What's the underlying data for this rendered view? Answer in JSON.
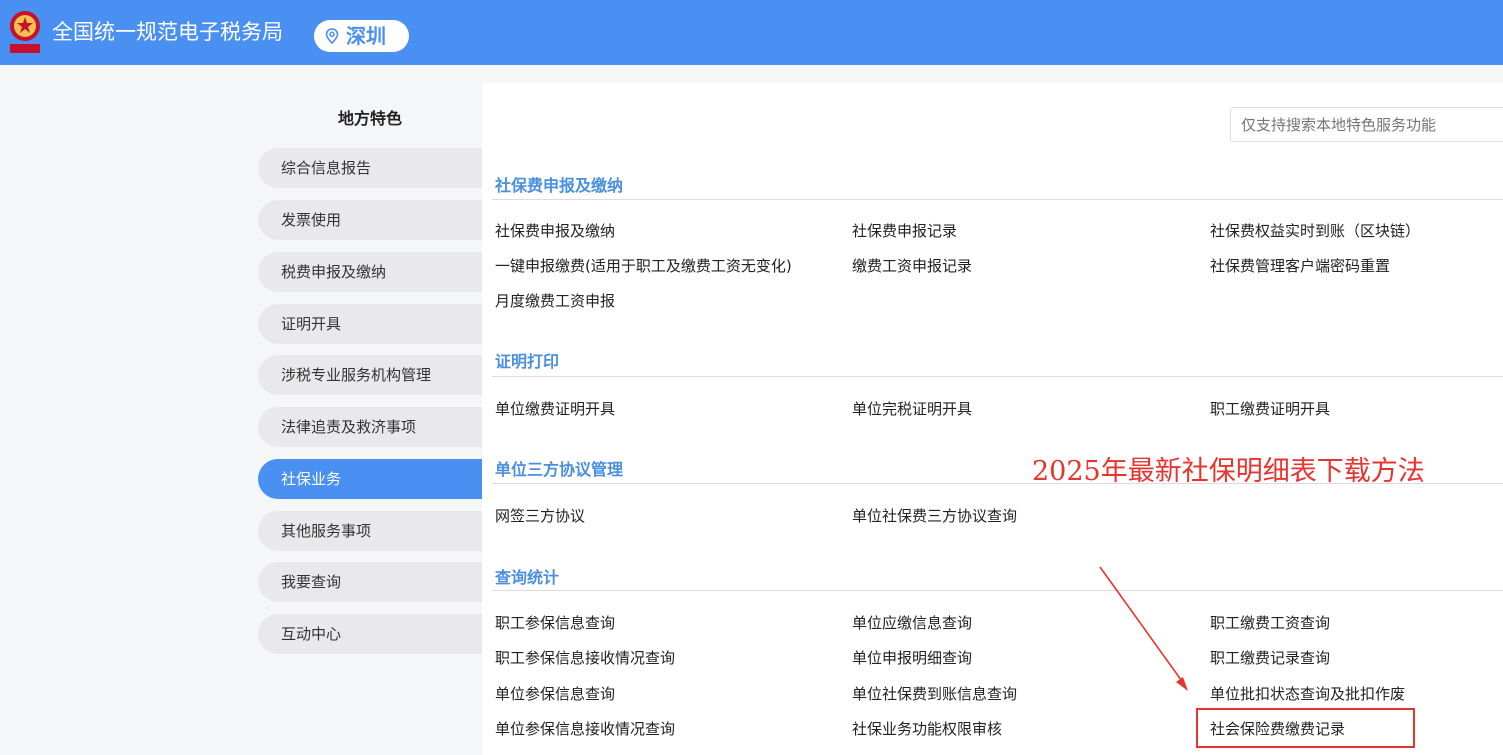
{
  "header": {
    "site_title": "全国统一规范电子税务局",
    "city": "深圳",
    "emblem_icon": "tax-emblem-icon",
    "pin_icon": "location-pin-icon"
  },
  "sidebar": {
    "title": "地方特色",
    "items": [
      {
        "label": "综合信息报告"
      },
      {
        "label": "发票使用"
      },
      {
        "label": "税费申报及缴纳"
      },
      {
        "label": "证明开具"
      },
      {
        "label": "涉税专业服务机构管理"
      },
      {
        "label": "法律追责及救济事项"
      },
      {
        "label": "社保业务",
        "active": true
      },
      {
        "label": "其他服务事项"
      },
      {
        "label": "我要查询"
      },
      {
        "label": "互动中心"
      }
    ]
  },
  "search": {
    "placeholder": "仅支持搜索本地特色服务功能"
  },
  "sections": [
    {
      "title": "社保费申报及缴纳",
      "items": [
        "社保费申报及缴纳",
        "社保费申报记录",
        "社保费权益实时到账（区块链）",
        "一键申报缴费(适用于职工及缴费工资无变化)",
        "缴费工资申报记录",
        "社保费管理客户端密码重置",
        "月度缴费工资申报"
      ]
    },
    {
      "title": "证明打印",
      "items": [
        "单位缴费证明开具",
        "单位完税证明开具",
        "职工缴费证明开具"
      ]
    },
    {
      "title": "单位三方协议管理",
      "items": [
        "网签三方协议",
        "单位社保费三方协议查询"
      ]
    },
    {
      "title": "查询统计",
      "items": [
        "职工参保信息查询",
        "单位应缴信息查询",
        "职工缴费工资查询",
        "职工参保信息接收情况查询",
        "单位申报明细查询",
        "职工缴费记录查询",
        "单位参保信息查询",
        "单位社保费到账信息查询",
        "单位批扣状态查询及批扣作废",
        "单位参保信息接收情况查询",
        "社保业务功能权限审核",
        "社会保险费缴费记录"
      ]
    }
  ],
  "annotation": {
    "text": "2025年最新社保明细表下载方法",
    "color": "#e8342f"
  },
  "colors": {
    "header": "#4a90f3",
    "accent": "#4a8fe0",
    "active": "#4a90f3"
  }
}
